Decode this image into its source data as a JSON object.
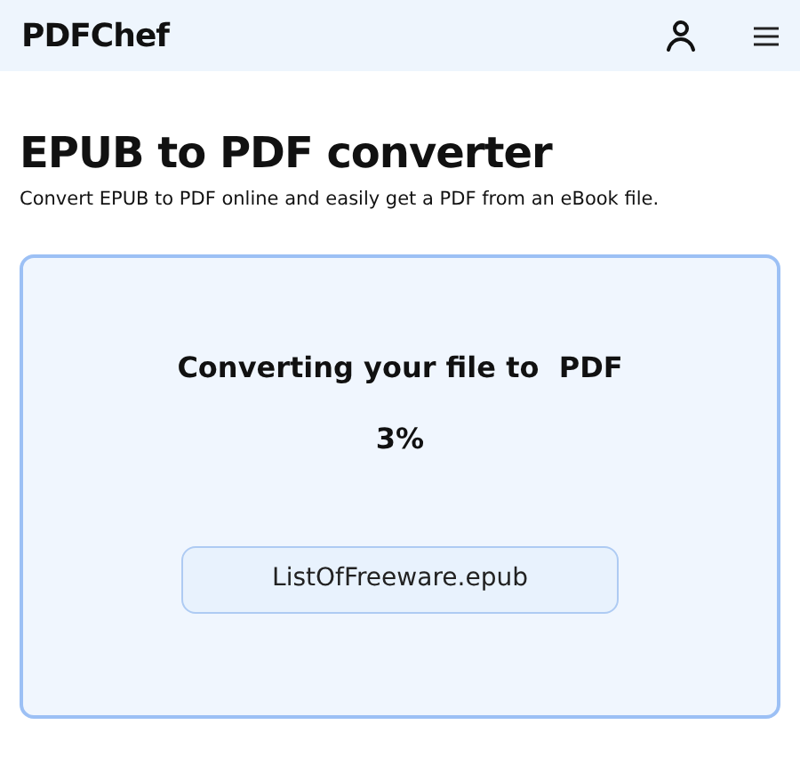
{
  "header": {
    "logo": "PDFChef"
  },
  "page": {
    "title": "EPUB to PDF converter",
    "subtitle": "Convert EPUB to PDF online and easily get a PDF from an eBook file."
  },
  "progress_panel": {
    "message": "Converting your file to  PDF",
    "percent": "3%",
    "file_name": "ListOfFreeware.epub"
  }
}
